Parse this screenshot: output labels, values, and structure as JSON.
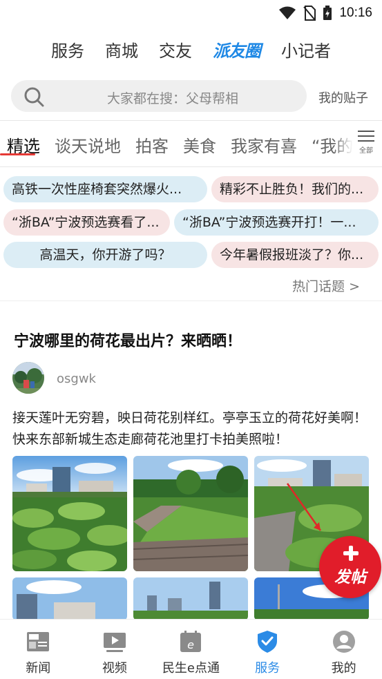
{
  "status_bar": {
    "time": "10:16"
  },
  "top_nav": {
    "items": [
      {
        "label": "服务"
      },
      {
        "label": "商城"
      },
      {
        "label": "交友"
      },
      {
        "label": "派友圈",
        "active": true
      },
      {
        "label": "小记者"
      }
    ]
  },
  "search": {
    "placeholder": "大家都在搜：父母帮相",
    "my_posts_label": "我的贴子"
  },
  "tabs": {
    "items": [
      "精选",
      "谈天说地",
      "拍客",
      "美食",
      "我家有喜",
      "“我的"
    ],
    "active_index": 0,
    "all_label": "全部"
  },
  "hot_topics": {
    "chips": [
      {
        "text": "高铁一次性座椅套突然爆火..."
      },
      {
        "text": "精彩不止胜负！我们的..."
      },
      {
        "text": "“浙BA”宁波预选赛看了..."
      },
      {
        "text": "“浙BA”宁波预选赛开打！一..."
      },
      {
        "text": "高温天，你开游了吗？"
      },
      {
        "text": "今年暑假报班淡了？你..."
      }
    ],
    "more_label": "热门话题 >"
  },
  "post": {
    "title": "宁波哪里的荷花最出片？来晒晒！",
    "author": "osgwk",
    "body": "接天莲叶无穷碧，映日荷花别样红。亭亭玉立的荷花好美啊！快来东部新城生态走廊荷花池里打卡拍美照啦！"
  },
  "fab": {
    "label": "发帖"
  },
  "bottom_nav": {
    "items": [
      {
        "label": "新闻",
        "icon": "news-icon"
      },
      {
        "label": "视频",
        "icon": "video-icon"
      },
      {
        "label": "民生e点通",
        "icon": "calendar-e-icon"
      },
      {
        "label": "服务",
        "icon": "shield-icon",
        "active": true
      },
      {
        "label": "我的",
        "icon": "user-icon"
      }
    ]
  },
  "colors": {
    "accent_blue": "#2b8be6",
    "tab_underline": "#e53935",
    "fab_red": "#e11d2a",
    "chip_blue": "#dcedf5",
    "chip_pink": "#f7e4e4"
  }
}
